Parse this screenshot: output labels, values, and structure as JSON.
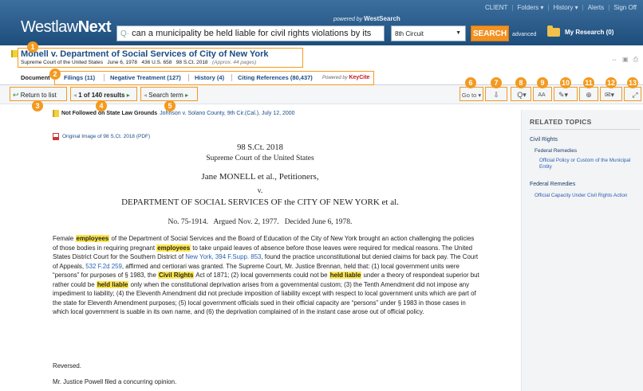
{
  "header": {
    "top_links": [
      "CLIENT",
      "Folders",
      "History",
      "Alerts",
      "Sign Off"
    ],
    "powered_by": "powered by",
    "powered_brand": "WestSearch",
    "logo_main": "Westlaw",
    "logo_next": "Next",
    "search_value": "can a municipality be held liable for civil rights violations by its",
    "jurisdiction": "8th Circuit",
    "search_button": "SEARCH",
    "advanced": "advanced",
    "research": "My Research (0)"
  },
  "document": {
    "title": "Monell v. Department of Social Services of City of New York",
    "court": "Supreme Court of the United States",
    "date": "June 6, 1978",
    "cite1": "436 U.S. 658",
    "cite2": "98 S.Ct. 2018",
    "pages": "(Approx. 44 pages)"
  },
  "tabs": [
    {
      "label": "Document"
    },
    {
      "label": "Filings (11)"
    },
    {
      "label": "Negative Treatment (127)"
    },
    {
      "label": "History (4)"
    },
    {
      "label": "Citing References (80,437)"
    }
  ],
  "keycite_prefix": "Powered by",
  "keycite_brand": "KeyCite",
  "toolbar": {
    "return_label": "Return to list",
    "results_label": "1 of 140 results",
    "search_term_label": "Search term",
    "goto_label": "Go to"
  },
  "callouts": [
    "1",
    "2",
    "3",
    "4",
    "5",
    "6",
    "7",
    "8",
    "9",
    "10",
    "11",
    "12",
    "13"
  ],
  "status": {
    "label": "Not Followed on State Law Grounds",
    "cite": "Johnson v. Solano County, 9th Cir.(Cal.), July 12, 2000"
  },
  "original_image": "Original Image of 98 S.Ct. 2018 (PDF)",
  "opinion": {
    "cite": "98 S.Ct. 2018",
    "court": "Supreme Court of the United States",
    "parties": "Jane MONELL et al., Petitioners,",
    "vs": "v.",
    "respondent": "DEPARTMENT OF SOCIAL SERVICES OF the CITY OF NEW YORK et al.",
    "dates": "No. 75-1914.   Argued Nov. 2, 1977.   Decided June 6, 1978."
  },
  "summary": {
    "s1": "Female ",
    "h1": "employees",
    "s2": " of the Department of Social Services and the Board of Education of the City of New York brought an action challenging the policies of those bodies in requiring pregnant ",
    "h2": "employees",
    "s3": " to take unpaid leaves of absence before those leaves were required for medical reasons. The United States District Court for the Southern District of ",
    "l1": "New York, 394 F.Supp. 853",
    "s4": ", found the practice unconstitutional but denied claims for back pay. The Court of Appeals, ",
    "l2": "532 F.2d 259",
    "s5": ", affirmed and certiorari was granted. The Supreme Court, Mr. Justice Brennan, held that: (1) local government units were “persons” for purposes of § 1983, the ",
    "h3": "Civil Rights",
    "s6": " Act of 1871; (2) local governments could not be ",
    "h4": "held liable",
    "s7": " under a theory of respondeat superior but rather could be ",
    "h5": "held liable",
    "s8": " only when the constitutional deprivation arises from a governmental custom; (3) the Tenth Amendment did not impose any impediment to liability; (4) the Eleventh Amendment did not preclude imposition of liability except with respect to local government units which are part of the state for Eleventh Amendment purposes; (5) local government officials sued in their official capacity are “persons” under § 1983 in those cases in which local government is suable in its own name, and (6) the deprivation complained of in the instant case arose out of official policy."
  },
  "reversed": "Reversed.",
  "concurring": "Mr. Justice Powell filed a concurring opinion.",
  "sidebar": {
    "heading": "RELATED TOPICS",
    "topic1": "Civil Rights",
    "sub1": "Federal Remedies",
    "link1a": "Official Policy or Custom of the Municipal",
    "link1b": "Entity",
    "topic2": "Federal Remedies",
    "link2": "Official Capacity Under Civil Rights Action"
  },
  "colors": {
    "header": "#1d4d7b",
    "accent": "#f39a1f",
    "search_button": "#f29222",
    "highlight": "#ffe74d",
    "link": "#2b60b0"
  }
}
